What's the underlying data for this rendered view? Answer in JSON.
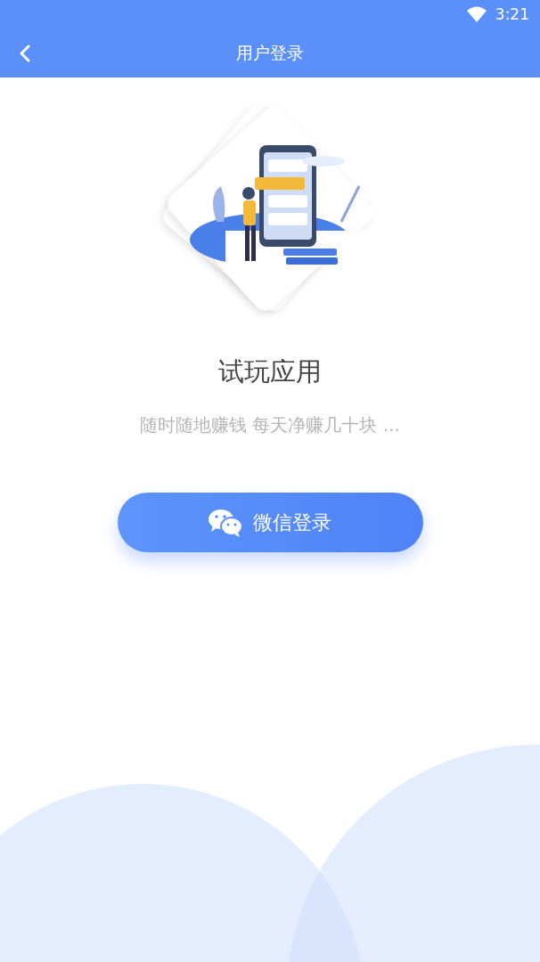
{
  "status_bar": {
    "time": "3:21"
  },
  "header": {
    "title": "用户登录"
  },
  "hero": {
    "title": "试玩应用",
    "subtitle": "随时随地赚钱 每天净赚几十块 ..."
  },
  "login_button": {
    "label": "微信登录"
  }
}
